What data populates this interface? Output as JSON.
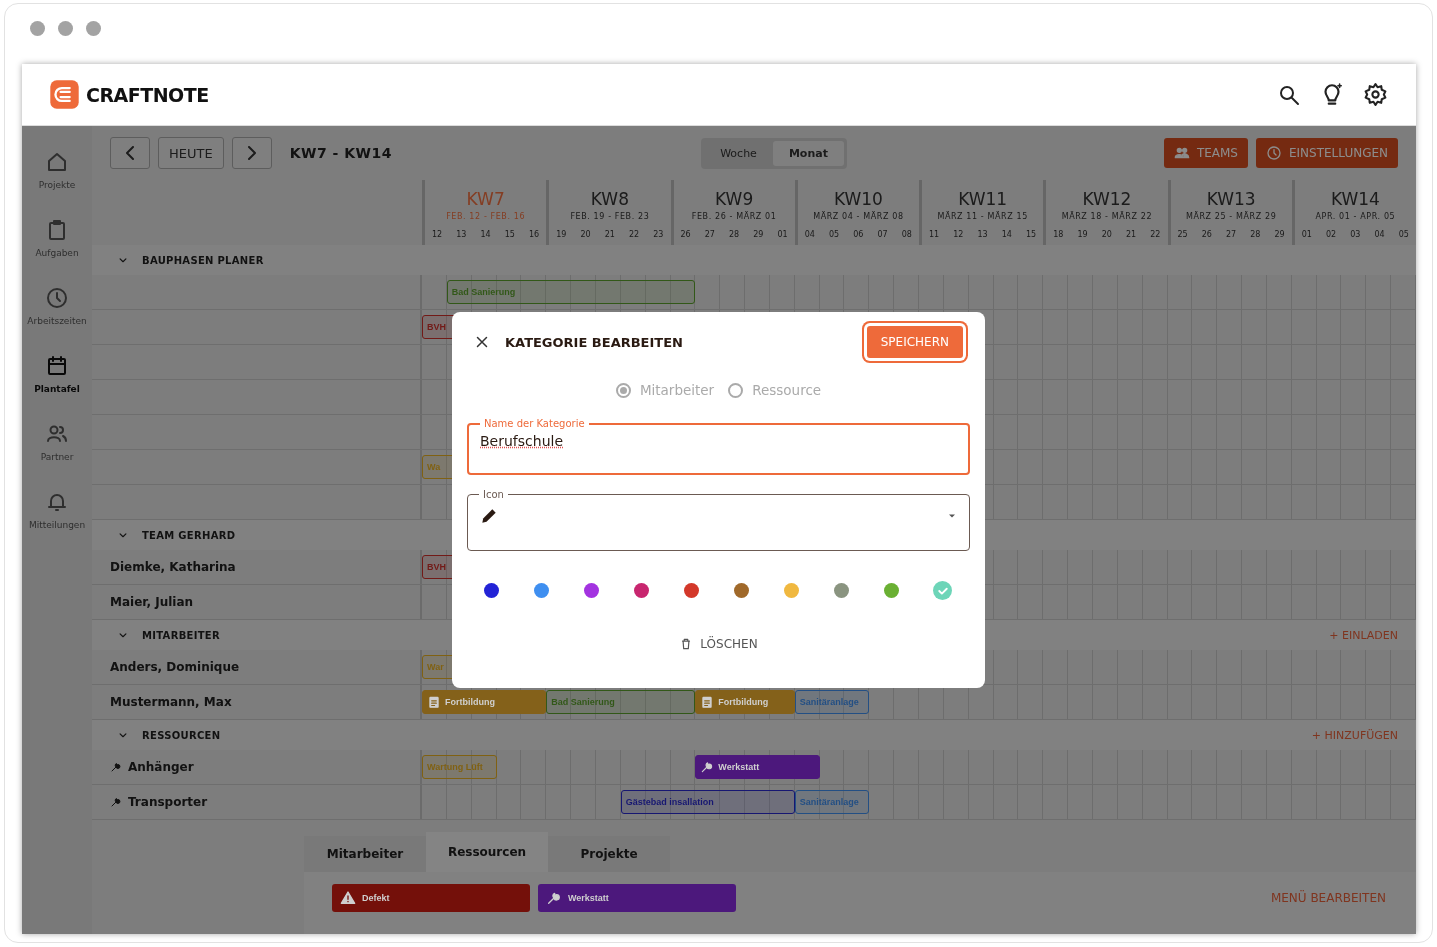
{
  "app": {
    "logo": "CRAFTNOTE"
  },
  "sidebar": {
    "items": [
      {
        "label": "Projekte",
        "kind": "projects",
        "selected": false
      },
      {
        "label": "Aufgaben",
        "kind": "tasks",
        "selected": false
      },
      {
        "label": "Arbeitszeiten",
        "kind": "times",
        "selected": false
      },
      {
        "label": "Plantafel",
        "kind": "planner",
        "selected": true
      },
      {
        "label": "Partner",
        "kind": "partners",
        "selected": false
      },
      {
        "label": "Mitteilungen",
        "kind": "notifications",
        "selected": false
      }
    ]
  },
  "toolbar": {
    "today": "HEUTE",
    "range": "KW7 - KW14",
    "views": [
      {
        "label": "Woche",
        "selected": false
      },
      {
        "label": "Monat",
        "selected": true
      }
    ],
    "buttons": [
      {
        "label": "TEAMS",
        "kind": "teams"
      },
      {
        "label": "EINSTELLUNGEN",
        "kind": "settings"
      }
    ]
  },
  "timeline": {
    "weeks": [
      {
        "label": "KW7",
        "dates": "FEB. 12 - FEB. 16",
        "days": [
          "12",
          "13",
          "14",
          "15",
          "16"
        ],
        "current": true
      },
      {
        "label": "KW8",
        "dates": "FEB. 19 - FEB. 23",
        "days": [
          "19",
          "20",
          "21",
          "22",
          "23"
        ],
        "current": false
      },
      {
        "label": "KW9",
        "dates": "FEB. 26 - MÄRZ 01",
        "days": [
          "26",
          "27",
          "28",
          "29",
          "01"
        ],
        "current": false
      },
      {
        "label": "KW10",
        "dates": "MÄRZ 04 - MÄRZ 08",
        "days": [
          "04",
          "05",
          "06",
          "07",
          "08"
        ],
        "current": false
      },
      {
        "label": "KW11",
        "dates": "MÄRZ 11 - MÄRZ 15",
        "days": [
          "11",
          "12",
          "13",
          "14",
          "15"
        ],
        "current": false
      },
      {
        "label": "KW12",
        "dates": "MÄRZ 18 - MÄRZ 22",
        "days": [
          "18",
          "19",
          "20",
          "21",
          "22"
        ],
        "current": false
      },
      {
        "label": "KW13",
        "dates": "MÄRZ 25 - MÄRZ 29",
        "days": [
          "25",
          "26",
          "27",
          "28",
          "29"
        ],
        "current": false
      },
      {
        "label": "KW14",
        "dates": "APR. 01 - APR. 05",
        "days": [
          "01",
          "02",
          "03",
          "04",
          "05"
        ],
        "current": false
      }
    ]
  },
  "sections": [
    {
      "title": "BAUPHASEN PLANER",
      "expanded": true,
      "rows": [
        {
          "kind": "blank",
          "bars": [
            {
              "label": "Bad Sanierung",
              "kind": "outline",
              "color": "#325818"
            }
          ]
        },
        {
          "kind": "blank",
          "bars": [
            {
              "label": "BVH",
              "kind": "outline",
              "color": "#721a17"
            }
          ]
        },
        {
          "kind": "blank",
          "bars": []
        },
        {
          "kind": "blank",
          "bars": []
        },
        {
          "kind": "blank",
          "bars": []
        },
        {
          "kind": "blank",
          "bars": [
            {
              "label": "Wa",
              "kind": "outline",
              "color": "#806112"
            }
          ]
        },
        {
          "kind": "blank",
          "bars": []
        }
      ]
    },
    {
      "title": "TEAM GERHARD",
      "expanded": true,
      "rows": [
        {
          "kind": "person",
          "label": "Diemke, Katharina",
          "bars": [
            {
              "label": "BVH",
              "kind": "outline",
              "color": "#721a17"
            }
          ]
        },
        {
          "kind": "person",
          "label": "Maier, Julian",
          "bars": []
        }
      ]
    },
    {
      "title": "MITARBEITER",
      "expanded": true,
      "action": "+ EINLADEN",
      "rows": [
        {
          "kind": "person",
          "label": "Anders, Dominique",
          "bars": [
            {
              "label": "War",
              "kind": "outline",
              "color": "#806112"
            }
          ]
        },
        {
          "kind": "person",
          "label": "Mustermann, Max",
          "bars": [
            {
              "label": "Fortbildung",
              "kind": "filled-note",
              "color": "#84611a"
            },
            {
              "label": "Bad Sanierung",
              "kind": "outline",
              "color": "#325818"
            },
            {
              "label": "Fortbildung",
              "kind": "filled-note",
              "color": "#84611a"
            },
            {
              "label": "Sanitäranlage",
              "kind": "outline",
              "color": "#234f84"
            }
          ]
        }
      ]
    },
    {
      "title": "RESSOURCEN",
      "expanded": true,
      "action": "+ HINZUFÜGEN",
      "rows": [
        {
          "kind": "resource",
          "label": "Anhänger",
          "bars": [
            {
              "label": "Wartung Lüft",
              "kind": "outline",
              "color": "#806112"
            },
            {
              "label": "Werkstatt",
              "kind": "filled-tool",
              "color": "#4c187c"
            }
          ]
        },
        {
          "kind": "resource",
          "label": "Transporter",
          "bars": [
            {
              "label": "Gästebad insallation",
              "kind": "outline",
              "color": "#171772"
            },
            {
              "label": "Sanitäranlage",
              "kind": "outline",
              "color": "#234f84"
            }
          ]
        }
      ]
    }
  ],
  "bottom_panel": {
    "tabs": [
      {
        "label": "Mitarbeiter",
        "selected": false
      },
      {
        "label": "Ressourcen",
        "selected": true
      },
      {
        "label": "Projekte",
        "selected": false
      }
    ],
    "chips": [
      {
        "label": "Defekt",
        "kind": "warning",
        "color": "#74100a"
      },
      {
        "label": "Werkstatt",
        "kind": "tool",
        "color": "#4c187c"
      }
    ],
    "action": "MENÜ BEARBEITEN"
  },
  "dialog": {
    "title": "KATEGORIE BEARBEITEN",
    "save": "SPEICHERN",
    "types_disabled": true,
    "types": [
      {
        "label": "Mitarbeiter",
        "selected": true
      },
      {
        "label": "Ressource",
        "selected": false
      }
    ],
    "name_field": {
      "label": "Name der Kategorie",
      "value": "Berufschule",
      "focused": true
    },
    "icon_field": {
      "label": "Icon"
    },
    "colors": [
      {
        "color": "#2323d6",
        "selected": false
      },
      {
        "color": "#3f8ff0",
        "selected": false
      },
      {
        "color": "#a333e0",
        "selected": false
      },
      {
        "color": "#c8266f",
        "selected": false
      },
      {
        "color": "#d3382a",
        "selected": false
      },
      {
        "color": "#a0692a",
        "selected": false
      },
      {
        "color": "#f0b840",
        "selected": false
      },
      {
        "color": "#8a9480",
        "selected": false
      },
      {
        "color": "#6ab033",
        "selected": false
      },
      {
        "color": "#6dd5b8",
        "selected": true
      }
    ],
    "delete": "LÖSCHEN"
  }
}
